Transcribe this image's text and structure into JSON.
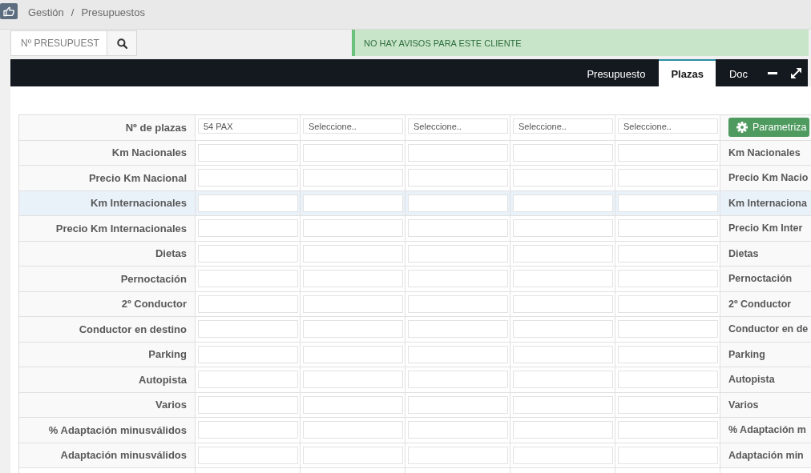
{
  "breadcrumb": {
    "items": [
      "Gestión",
      "Presupuestos"
    ],
    "separator": "/"
  },
  "search": {
    "placeholder": "Nº PRESUPUEST"
  },
  "alert": {
    "text": "NO HAY AVISOS PARA ESTE CLIENTE"
  },
  "tabs": [
    {
      "label": "Presupuesto",
      "selected": false
    },
    {
      "label": "Plazas",
      "selected": true
    },
    {
      "label": "Doc",
      "selected": false
    }
  ],
  "table": {
    "rows": [
      {
        "label": "Nº de plazas",
        "highlighted": false,
        "cells": [
          {
            "kind": "select",
            "value": "54 PAX"
          },
          {
            "kind": "select",
            "value": "Seleccione.."
          },
          {
            "kind": "select",
            "value": "Seleccione.."
          },
          {
            "kind": "select",
            "value": "Seleccione.."
          },
          {
            "kind": "select",
            "value": "Seleccione.."
          }
        ],
        "side": {
          "kind": "button",
          "label": "Parametriza"
        }
      },
      {
        "label": "Km Nacionales",
        "highlighted": false,
        "cells": [
          {
            "kind": "input"
          },
          {
            "kind": "input"
          },
          {
            "kind": "input"
          },
          {
            "kind": "input"
          },
          {
            "kind": "input"
          }
        ],
        "side": {
          "kind": "label",
          "text": "Km Nacionales"
        }
      },
      {
        "label": "Precio Km Nacional",
        "highlighted": false,
        "cells": [
          {
            "kind": "input"
          },
          {
            "kind": "input"
          },
          {
            "kind": "input"
          },
          {
            "kind": "input"
          },
          {
            "kind": "input"
          }
        ],
        "side": {
          "kind": "label",
          "text": "Precio Km Nacio"
        }
      },
      {
        "label": "Km Internacionales",
        "highlighted": true,
        "cells": [
          {
            "kind": "input"
          },
          {
            "kind": "input"
          },
          {
            "kind": "input"
          },
          {
            "kind": "input"
          },
          {
            "kind": "input"
          }
        ],
        "side": {
          "kind": "label",
          "text": "Km Internaciona"
        }
      },
      {
        "label": "Precio Km Internacionales",
        "highlighted": false,
        "cells": [
          {
            "kind": "input"
          },
          {
            "kind": "input"
          },
          {
            "kind": "input"
          },
          {
            "kind": "input"
          },
          {
            "kind": "input"
          }
        ],
        "side": {
          "kind": "label",
          "text": "Precio Km Inter"
        }
      },
      {
        "label": "Dietas",
        "highlighted": false,
        "cells": [
          {
            "kind": "input"
          },
          {
            "kind": "input"
          },
          {
            "kind": "input"
          },
          {
            "kind": "input"
          },
          {
            "kind": "input"
          }
        ],
        "side": {
          "kind": "label",
          "text": "Dietas"
        }
      },
      {
        "label": "Pernoctación",
        "highlighted": false,
        "cells": [
          {
            "kind": "input"
          },
          {
            "kind": "input"
          },
          {
            "kind": "input"
          },
          {
            "kind": "input"
          },
          {
            "kind": "input"
          }
        ],
        "side": {
          "kind": "label",
          "text": "Pernoctación"
        }
      },
      {
        "label": "2º Conductor",
        "highlighted": false,
        "cells": [
          {
            "kind": "input"
          },
          {
            "kind": "input"
          },
          {
            "kind": "input"
          },
          {
            "kind": "input"
          },
          {
            "kind": "input"
          }
        ],
        "side": {
          "kind": "label",
          "text": "2º Conductor"
        }
      },
      {
        "label": "Conductor en destino",
        "highlighted": false,
        "cells": [
          {
            "kind": "input"
          },
          {
            "kind": "input"
          },
          {
            "kind": "input"
          },
          {
            "kind": "input"
          },
          {
            "kind": "input"
          }
        ],
        "side": {
          "kind": "label",
          "text": "Conductor en de"
        }
      },
      {
        "label": "Parking",
        "highlighted": false,
        "cells": [
          {
            "kind": "input"
          },
          {
            "kind": "input"
          },
          {
            "kind": "input"
          },
          {
            "kind": "input"
          },
          {
            "kind": "input"
          }
        ],
        "side": {
          "kind": "label",
          "text": "Parking"
        }
      },
      {
        "label": "Autopista",
        "highlighted": false,
        "cells": [
          {
            "kind": "input"
          },
          {
            "kind": "input"
          },
          {
            "kind": "input"
          },
          {
            "kind": "input"
          },
          {
            "kind": "input"
          }
        ],
        "side": {
          "kind": "label",
          "text": "Autopista"
        }
      },
      {
        "label": "Varios",
        "highlighted": false,
        "cells": [
          {
            "kind": "input"
          },
          {
            "kind": "input"
          },
          {
            "kind": "input"
          },
          {
            "kind": "input"
          },
          {
            "kind": "input"
          }
        ],
        "side": {
          "kind": "label",
          "text": "Varios"
        }
      },
      {
        "label": "% Adaptación minusválidos",
        "highlighted": false,
        "cells": [
          {
            "kind": "input"
          },
          {
            "kind": "input"
          },
          {
            "kind": "input"
          },
          {
            "kind": "input"
          },
          {
            "kind": "input"
          }
        ],
        "side": {
          "kind": "label",
          "text": "% Adaptación m"
        }
      },
      {
        "label": "Adaptación minusválidos",
        "highlighted": false,
        "cells": [
          {
            "kind": "input"
          },
          {
            "kind": "input"
          },
          {
            "kind": "input"
          },
          {
            "kind": "input"
          },
          {
            "kind": "input"
          }
        ],
        "side": {
          "kind": "label",
          "text": "Adaptación min"
        }
      }
    ]
  }
}
